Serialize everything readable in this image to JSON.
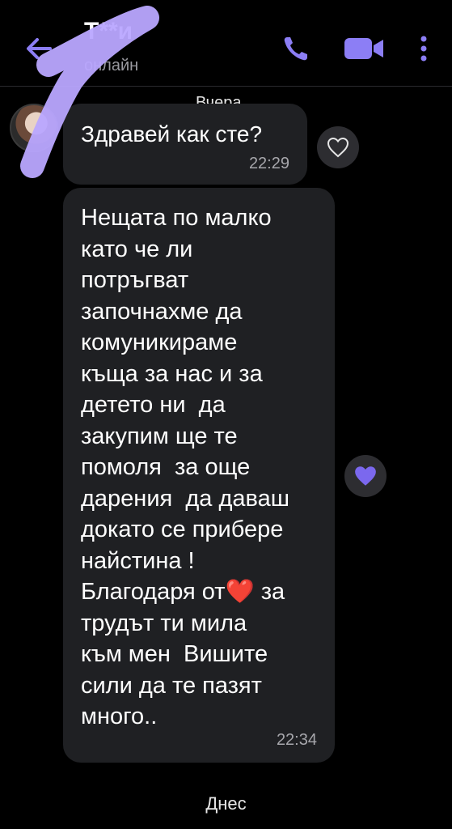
{
  "header": {
    "title": "Т**и",
    "status": "онлайн",
    "icons": {
      "back": "back-arrow-icon",
      "call": "phone-icon",
      "video": "video-camera-icon",
      "more": "more-vertical-icon"
    },
    "accent_color": "#7b68ee"
  },
  "chat": {
    "date_divider_yesterday": "Вчера",
    "messages": [
      {
        "text": "Здравей как сте?",
        "time": "22:29",
        "liked": false
      },
      {
        "text": "Нещата по малко\nкато че ли\nпотръгват\nзапочнахме да\nкомуникираме\nкъща за нас и за\nдетето ни  да\nзакупим ще те\nпомоля  за още\nдарения  да даваш\nдокато се прибере\nнайстина !\nБлагодаря от❤️ за\nтрудът ти мила\nкъм мен  Вишите\nсили да те пазят\nмного..",
        "time": "22:34",
        "liked": true
      }
    ],
    "date_divider_today": "Днес"
  },
  "colors": {
    "background": "#000000",
    "bubble": "#1f2023",
    "like_filled": "#7b68ee",
    "scribble": "#b9a6ff"
  }
}
